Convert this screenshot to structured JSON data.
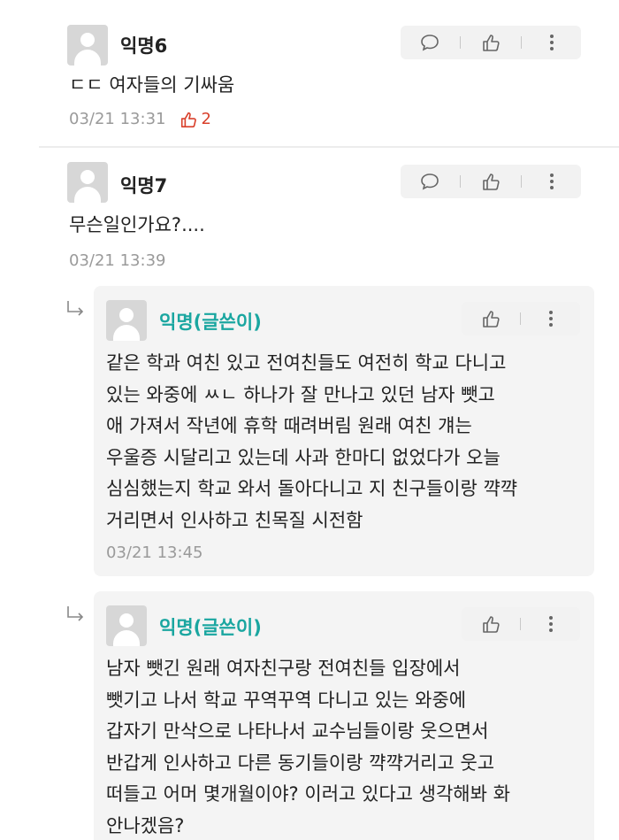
{
  "comments": [
    {
      "name": "익명6",
      "text": "ㄷㄷ 여자들의 기싸움",
      "date": "03/21 13:31",
      "likes": "2"
    },
    {
      "name": "익명7",
      "text": "무슨일인가요?....",
      "date": "03/21 13:39"
    }
  ],
  "replies": [
    {
      "name": "익명(글쓴이)",
      "text": "같은 학과 여친 있고 전여친들도 여전히 학교 다니고\n있는 와중에 ㅆㄴ 하나가 잘 만나고 있던 남자 뺏고\n애 가져서 작년에 휴학 때려버림 원래 여친 걔는\n우울증 시달리고 있는데 사과 한마디 없었다가 오늘\n심심했는지 학교 와서 돌아다니고 지 친구들이랑 꺅꺅\n거리면서 인사하고 친목질 시전함",
      "date": "03/21 13:45"
    },
    {
      "name": "익명(글쓴이)",
      "text": "남자 뺏긴 원래 여자친구랑 전여친들 입장에서\n뺏기고 나서 학교 꾸역꾸역 다니고 있는 와중에\n갑자기 만삭으로 나타나서 교수님들이랑 웃으면서\n반갑게 인사하고 다른 동기들이랑 꺅꺅거리고 웃고\n떠들고 어머 몇개월이야? 이러고 있다고 생각해봐 화\n안나겠음?"
    }
  ],
  "icons": {
    "comment": "speech-bubble",
    "like": "thumbs-up",
    "more": "vertical-ellipsis",
    "reply": "reply-arrow"
  },
  "colors": {
    "writer_name": "#1aa6a0",
    "like_count": "#d9412c",
    "meta": "#9a9a9a"
  }
}
